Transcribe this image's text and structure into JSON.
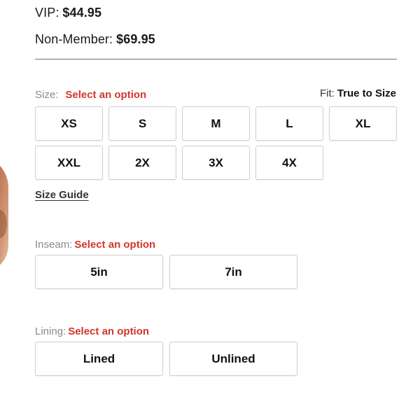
{
  "pricing": {
    "vip_label": "VIP:",
    "vip_price": "$44.95",
    "nonmember_label": "Non-Member:",
    "nonmember_price": "$69.95"
  },
  "size": {
    "label": "Size:",
    "prompt": "Select an option",
    "fit_label": "Fit:",
    "fit_value": "True to Size",
    "options": [
      "XS",
      "S",
      "M",
      "L",
      "XL",
      "XXL",
      "2X",
      "3X",
      "4X"
    ],
    "guide_link": "Size Guide"
  },
  "inseam": {
    "label": "Inseam:",
    "prompt": "Select an option",
    "options": [
      "5in",
      "7in"
    ]
  },
  "lining": {
    "label": "Lining:",
    "prompt": "Select an option",
    "options": [
      "Lined",
      "Unlined"
    ]
  },
  "colors": {
    "prompt_red": "#d2362b",
    "label_gray": "#8a8a8a",
    "border_gray": "#cfcfcf"
  }
}
